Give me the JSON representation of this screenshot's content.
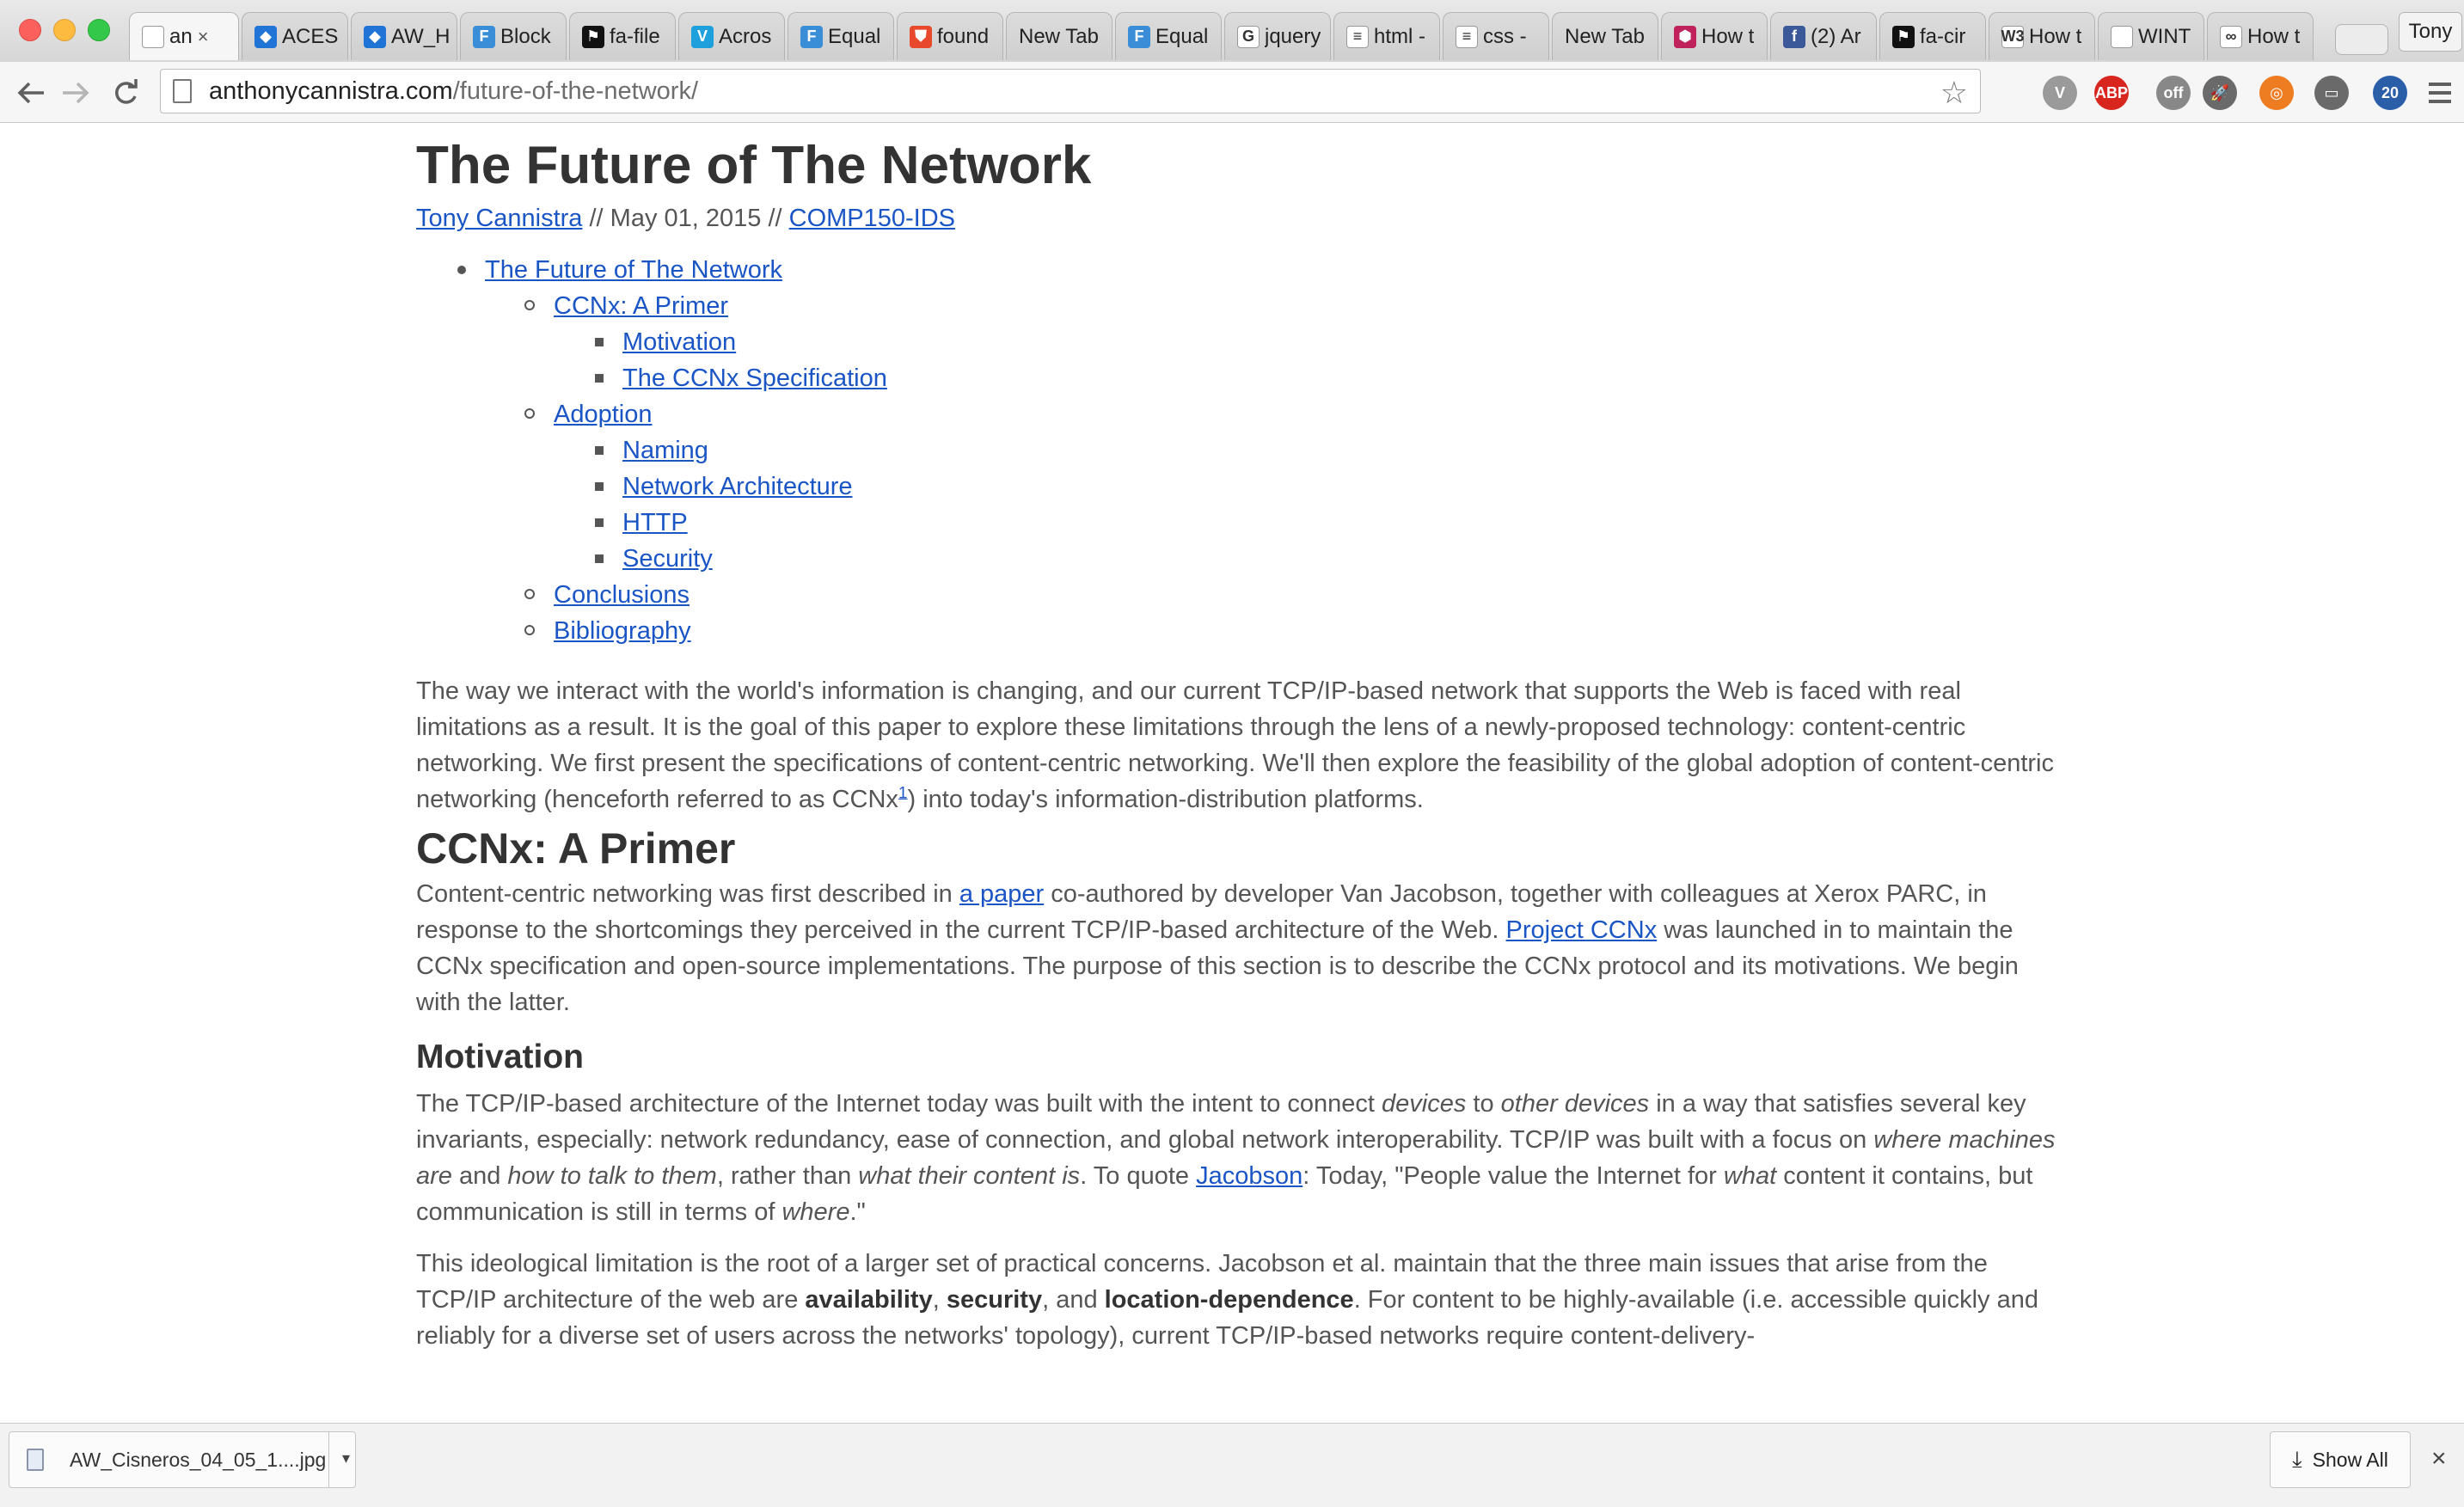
{
  "browser": {
    "profile_name": "Tony",
    "url_domain": "anthonycannistra.com",
    "url_path": "/future-of-the-network/",
    "tabs": [
      {
        "title": "an",
        "icon": "page-icon",
        "color": "#ffffff",
        "glyph": ""
      },
      {
        "title": "ACES",
        "icon": "dropbox-icon",
        "color": "#1f74d6",
        "glyph": "◆"
      },
      {
        "title": "AW_H",
        "icon": "dropbox-icon",
        "color": "#1f74d6",
        "glyph": "◆"
      },
      {
        "title": "Block",
        "icon": "f-logo-icon",
        "color": "#3a8ed8",
        "glyph": "F"
      },
      {
        "title": "fa-file",
        "icon": "flag-icon",
        "color": "#111111",
        "glyph": "⚑"
      },
      {
        "title": "Acros",
        "icon": "v-logo-icon",
        "color": "#1ea0dc",
        "glyph": "V"
      },
      {
        "title": "Equal",
        "icon": "f-logo-icon",
        "color": "#3a8ed8",
        "glyph": "F"
      },
      {
        "title": "found",
        "icon": "shield-icon",
        "color": "#e8482b",
        "glyph": "⛊"
      },
      {
        "title": "New Tab",
        "icon": "",
        "color": "",
        "glyph": ""
      },
      {
        "title": "Equal",
        "icon": "f-logo-icon",
        "color": "#3a8ed8",
        "glyph": "F"
      },
      {
        "title": "jquery",
        "icon": "google-icon",
        "color": "#ffffff",
        "glyph": "G"
      },
      {
        "title": "html -",
        "icon": "stackoverflow-icon",
        "color": "#ffffff",
        "glyph": "≡"
      },
      {
        "title": "css -",
        "icon": "stackoverflow-icon",
        "color": "#ffffff",
        "glyph": "≡"
      },
      {
        "title": "New Tab",
        "icon": "",
        "color": "",
        "glyph": ""
      },
      {
        "title": "How t",
        "icon": "hexagon-icon",
        "color": "#c0235c",
        "glyph": "⬢"
      },
      {
        "title": "(2) Ar",
        "icon": "facebook-icon",
        "color": "#3b5998",
        "glyph": "f"
      },
      {
        "title": "fa-cir",
        "icon": "flag-icon",
        "color": "#111111",
        "glyph": "⚑"
      },
      {
        "title": "How t",
        "icon": "w3-icon",
        "color": "#ffffff",
        "glyph": "W3"
      },
      {
        "title": "WINT",
        "icon": "page-icon",
        "color": "#ffffff",
        "glyph": ""
      },
      {
        "title": "How t",
        "icon": "codepen-icon",
        "color": "#ffffff",
        "glyph": "∞"
      }
    ],
    "extensions": [
      {
        "name": "vimeo-extension-icon",
        "color": "#9a9a9a",
        "glyph": "V"
      },
      {
        "name": "adblock-icon",
        "color": "#d8261f",
        "glyph": "ABP"
      },
      {
        "name": "mascot-extension-icon",
        "color": "#888888",
        "glyph": "off"
      },
      {
        "name": "rocket-icon",
        "color": "#6a6a6a",
        "glyph": "🚀"
      },
      {
        "name": "lifebuoy-icon",
        "color": "#ee7d22",
        "glyph": "◎"
      },
      {
        "name": "cast-icon",
        "color": "#6a6a6a",
        "glyph": "▭"
      },
      {
        "name": "badge-extension-icon",
        "color": "#2a5ea8",
        "glyph": "20"
      }
    ]
  },
  "article": {
    "title": "The Future of The Network",
    "author": "Tony Cannistra",
    "date_sep": " // May 01, 2015 // ",
    "category": "COMP150-IDS",
    "toc": [
      {
        "label": "The Future of The Network",
        "level": 1
      },
      {
        "label": "CCNx: A Primer",
        "level": 2
      },
      {
        "label": "Motivation",
        "level": 3
      },
      {
        "label": "The CCNx Specification",
        "level": 3
      },
      {
        "label": "Adoption",
        "level": 2
      },
      {
        "label": "Naming",
        "level": 3
      },
      {
        "label": "Network Architecture",
        "level": 3
      },
      {
        "label": "HTTP",
        "level": 3
      },
      {
        "label": "Security",
        "level": 3
      },
      {
        "label": "Conclusions",
        "level": 2
      },
      {
        "label": "Bibliography",
        "level": 2
      }
    ],
    "intro": {
      "text": "The way we interact with the world's information is changing, and our current TCP/IP-based network that supports the Web is faced with real limitations as a result. It is the goal of this paper to explore these limitations through the lens of a newly-proposed technology: content-centric networking. We first present the specifications of content-centric networking. We'll then explore the feasibility of the global adoption of content-centric networking (henceforth referred to as CCNx",
      "footnote": "1",
      "tail": ") into today's information-distribution platforms."
    },
    "primer_heading": "CCNx: A Primer",
    "primer": {
      "t1": "Content-centric networking was first described in ",
      "link1": "a paper",
      "t2": " co-authored by developer Van Jacobson, together with colleagues at Xerox PARC, in response to the shortcomings they perceived in the current TCP/IP-based architecture of the Web. ",
      "link2": "Project CCNx",
      "t3": " was launched in to maintain the CCNx specification and open-source implementations. The purpose of this section is to describe the CCNx protocol and its motivations. We begin with the latter."
    },
    "motivation_heading": "Motivation",
    "motivation_p1": {
      "t1": "The TCP/IP-based architecture of the Internet today was built with the intent to connect ",
      "e1": "devices",
      "t2": " to ",
      "e2": "other devices",
      "t3": " in a way that satisfies several key invariants, especially: network redundancy, ease of connection, and global network interoperability. TCP/IP was built with a focus on ",
      "e3": "where machines are",
      "t4": " and ",
      "e4": "how to talk to them",
      "t5": ", rather than ",
      "e5": "what their content is",
      "t6": ". To quote ",
      "link": "Jacobson",
      "t7": ": Today, \"People value the Internet for ",
      "e6": "what",
      "t8": " content it contains, but communication is still in terms of ",
      "e7": "where",
      "t9": ".\""
    },
    "motivation_p2": {
      "t1": "This ideological limitation is the root of a larger set of practical concerns. Jacobson et al. maintain that the three main issues that arise from the TCP/IP architecture of the web are ",
      "b1": "availability",
      "t2": ", ",
      "b2": "security",
      "t3": ", and ",
      "b3": "location-dependence",
      "t4": ". For content to be highly-available (i.e. accessible quickly and reliably for a diverse set of users across the networks' topology), current TCP/IP-based networks require content-delivery-"
    }
  },
  "downloads": {
    "filename": "AW_Cisneros_04_05_1....jpg",
    "show_all": "Show All"
  }
}
